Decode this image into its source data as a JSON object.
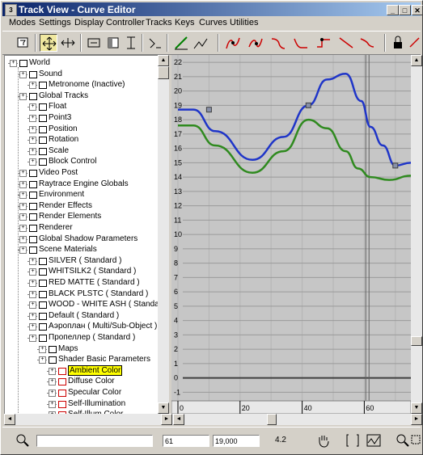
{
  "window": {
    "title": "Track View - Curve Editor"
  },
  "menu": [
    "Modes",
    "Settings",
    "Display",
    "Controller",
    "Tracks",
    "Keys",
    "Curves",
    "Utilities"
  ],
  "toolbar_icons": [
    "filter-icon",
    "move-keys-icon",
    "slide-keys-icon",
    "scale-keys-icon",
    "scale-values-icon",
    "add-keys-icon",
    "draw-curves-icon",
    "reduce-keys-icon",
    "set-tangents-auto-icon",
    "set-tangents-custom-icon",
    "set-tangents-fast-icon",
    "set-tangents-slow-icon",
    "set-tangents-step-icon",
    "set-tangents-linear-icon",
    "set-tangents-smooth-icon",
    "lock-selection-icon",
    "snap-frames-icon"
  ],
  "tree": [
    {
      "label": "World",
      "level": 0
    },
    {
      "label": "Sound",
      "level": 1
    },
    {
      "label": "Metronome (Inactive)",
      "level": 2
    },
    {
      "label": "Global Tracks",
      "level": 1
    },
    {
      "label": "Float",
      "level": 2
    },
    {
      "label": "Point3",
      "level": 2
    },
    {
      "label": "Position",
      "level": 2
    },
    {
      "label": "Rotation",
      "level": 2
    },
    {
      "label": "Scale",
      "level": 2
    },
    {
      "label": "Block Control",
      "level": 2
    },
    {
      "label": "Video Post",
      "level": 1
    },
    {
      "label": "Raytrace Engine Globals",
      "level": 1
    },
    {
      "label": "Environment",
      "level": 1
    },
    {
      "label": "Render Effects",
      "level": 1
    },
    {
      "label": "Render Elements",
      "level": 1
    },
    {
      "label": "Renderer",
      "level": 1
    },
    {
      "label": "Global Shadow Parameters",
      "level": 1
    },
    {
      "label": "Scene Materials",
      "level": 1
    },
    {
      "label": "SILVER  ( Standard )",
      "level": 2
    },
    {
      "label": "WHITSILK2  ( Standard )",
      "level": 2
    },
    {
      "label": "RED MATTE  ( Standard )",
      "level": 2
    },
    {
      "label": "BLACK PLSTC  ( Standard )",
      "level": 2
    },
    {
      "label": "WOOD - WHITE ASH  ( Standard )",
      "level": 2
    },
    {
      "label": "Default  ( Standard )",
      "level": 2
    },
    {
      "label": "Аэроплан  ( Multi/Sub-Object )",
      "level": 2
    },
    {
      "label": "Пропеллер  ( Standard )",
      "level": 2
    },
    {
      "label": "Maps",
      "level": 3
    },
    {
      "label": "Shader Basic Parameters",
      "level": 3
    },
    {
      "label": "Ambient Color",
      "level": 4,
      "selected": true
    },
    {
      "label": "Diffuse Color",
      "level": 4
    },
    {
      "label": "Specular Color",
      "level": 4
    },
    {
      "label": "Self-Illumination",
      "level": 4
    },
    {
      "label": "Self-Illum Color",
      "level": 4
    }
  ],
  "chart_data": {
    "type": "line",
    "y_ticks": [
      22,
      21,
      20,
      19,
      18,
      17,
      16,
      15,
      14,
      13,
      12,
      11,
      10,
      9,
      8,
      7,
      6,
      5,
      4,
      3,
      2,
      1,
      0,
      -1
    ],
    "x_ticks": [
      "0",
      "20",
      "40",
      "60"
    ],
    "ylim": [
      -1.6,
      22.4
    ],
    "xlim": [
      0,
      75
    ],
    "series": [
      {
        "color": "#1f35c8",
        "points": [
          [
            0,
            18.7
          ],
          [
            5,
            18.7
          ],
          [
            12,
            17.2
          ],
          [
            24,
            15.2
          ],
          [
            34,
            16.8
          ],
          [
            42,
            19.0
          ],
          [
            48,
            20.8
          ],
          [
            54,
            21.2
          ],
          [
            59,
            19.3
          ],
          [
            62,
            17.5
          ],
          [
            66,
            16.2
          ],
          [
            70,
            14.8
          ],
          [
            75,
            15.0
          ]
        ]
      },
      {
        "color": "#2f8a1f",
        "points": [
          [
            0,
            17.6
          ],
          [
            5,
            17.6
          ],
          [
            12,
            16.2
          ],
          [
            24,
            14.3
          ],
          [
            34,
            15.8
          ],
          [
            42,
            18.0
          ],
          [
            48,
            17.4
          ],
          [
            54,
            15.8
          ],
          [
            58,
            14.6
          ],
          [
            62,
            14.0
          ],
          [
            68,
            13.8
          ],
          [
            75,
            14.1
          ]
        ]
      }
    ],
    "keys": [
      [
        10,
        18.7
      ],
      [
        42,
        19.0
      ],
      [
        70,
        14.8
      ]
    ],
    "current_frame": 61
  },
  "status": {
    "frame_value": "61",
    "value_field": "19,000",
    "zoom_label": "4.2"
  }
}
